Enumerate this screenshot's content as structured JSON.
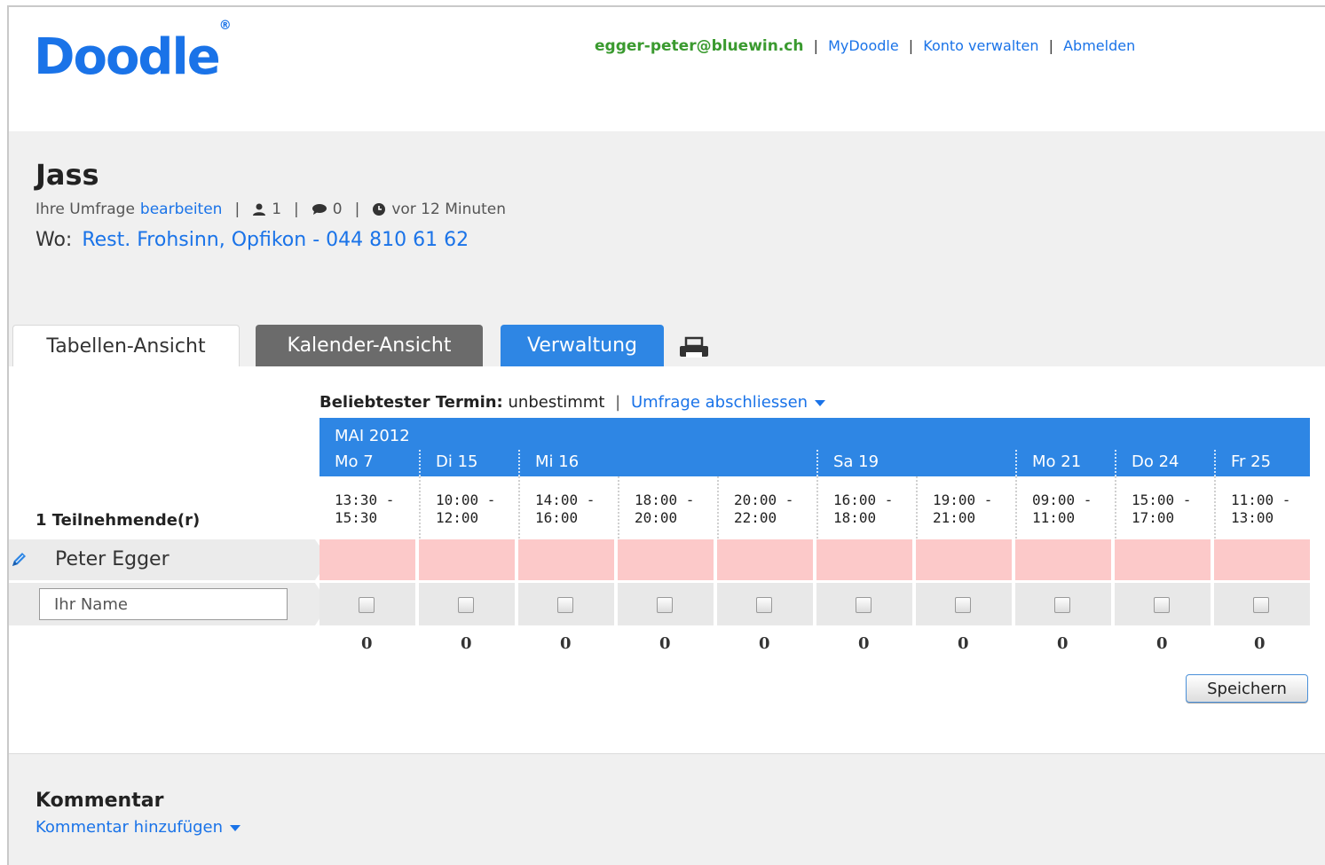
{
  "header": {
    "logo": "Doodle",
    "logo_mark": "®",
    "user_email": "egger-peter@bluewin.ch",
    "sep": "|",
    "nav": [
      "MyDoodle",
      "Konto verwalten",
      "Abmelden"
    ]
  },
  "poll": {
    "title": "Jass",
    "meta_prefix": "Ihre Umfrage",
    "edit_link": "bearbeiten",
    "participants_count": "1",
    "comments_count": "0",
    "time_ago": "vor 12 Minuten",
    "where_label": "Wo:",
    "where_value": "Rest. Frohsinn, Opfikon - 044 810 61 62"
  },
  "tabs": {
    "table": "Tabellen-Ansicht",
    "calendar": "Kalender-Ansicht",
    "admin": "Verwaltung"
  },
  "best": {
    "label": "Beliebtester Termin:",
    "value": "unbestimmt",
    "sep": "|",
    "close_link": "Umfrage abschliessen"
  },
  "table": {
    "month": "MAI 2012",
    "days": [
      "Mo 7",
      "Di 15",
      "Mi 16",
      "Sa 19",
      "Mo 21",
      "Do 24",
      "Fr 25"
    ],
    "slots": [
      {
        "start": "13:30 -",
        "end": "15:30"
      },
      {
        "start": "10:00 -",
        "end": "12:00"
      },
      {
        "start": "14:00 -",
        "end": "16:00"
      },
      {
        "start": "18:00 -",
        "end": "20:00"
      },
      {
        "start": "20:00 -",
        "end": "22:00"
      },
      {
        "start": "16:00 -",
        "end": "18:00"
      },
      {
        "start": "19:00 -",
        "end": "21:00"
      },
      {
        "start": "09:00 -",
        "end": "11:00"
      },
      {
        "start": "15:00 -",
        "end": "17:00"
      },
      {
        "start": "11:00 -",
        "end": "13:00"
      }
    ],
    "participants_label": "1 Teilnehmende(r)",
    "participant_name": "Peter Egger",
    "name_placeholder": "Ihr Name",
    "counts": [
      "0",
      "0",
      "0",
      "0",
      "0",
      "0",
      "0",
      "0",
      "0",
      "0"
    ],
    "save_label": "Speichern"
  },
  "comments": {
    "title": "Kommentar",
    "add_link": "Kommentar hinzufügen"
  },
  "colors": {
    "brand_blue": "#2e86e4",
    "link_blue": "#1a73e8",
    "user_green": "#3a9a2f",
    "no_vote_pink": "#fcc9c9"
  }
}
